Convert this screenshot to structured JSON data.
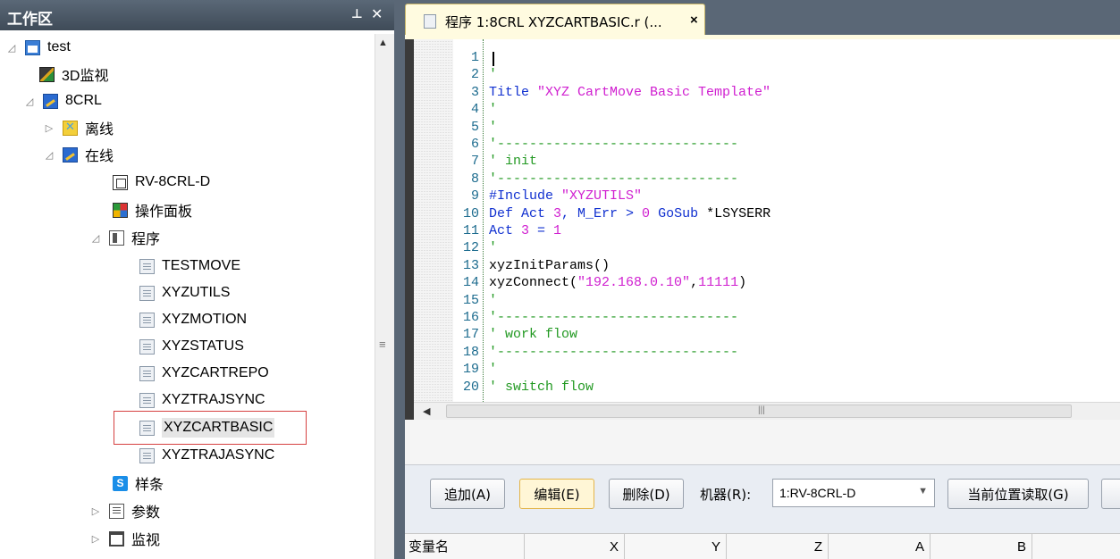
{
  "workspace": {
    "title": "工作区",
    "pin_glyph": "ᵖ",
    "close_glyph": "✕"
  },
  "tree": {
    "project": "test",
    "monitor3d": "3D监视",
    "robot": "8CRL",
    "offline": "离线",
    "online": "在线",
    "controller": "RV-8CRL-D",
    "op_panel": "操作面板",
    "programs": "程序",
    "program_files": [
      "TESTMOVE",
      "XYZUTILS",
      "XYZMOTION",
      "XYZSTATUS",
      "XYZCARTREPO",
      "XYZTRAJSYNC",
      "XYZCARTBASIC",
      "XYZTRAJASYNC"
    ],
    "selected": "XYZCARTBASIC",
    "spline": "样条",
    "params": "参数",
    "monitor": "监视"
  },
  "editor_tab": {
    "title": "程序 1:8CRL XYZCARTBASIC.r (...",
    "close_glyph": "×"
  },
  "code_lines": [
    {
      "n": "1",
      "parts": [
        {
          "t": "",
          "c": "tx"
        }
      ]
    },
    {
      "n": "2",
      "parts": [
        {
          "t": "'",
          "c": "cm"
        }
      ]
    },
    {
      "n": "3",
      "parts": [
        {
          "t": "Title ",
          "c": "kw"
        },
        {
          "t": "\"XYZ CartMove Basic Template\"",
          "c": "str"
        }
      ]
    },
    {
      "n": "4",
      "parts": [
        {
          "t": "'",
          "c": "cm"
        }
      ]
    },
    {
      "n": "5",
      "parts": [
        {
          "t": "'",
          "c": "cm"
        }
      ]
    },
    {
      "n": "6",
      "parts": [
        {
          "t": "'------------------------------",
          "c": "cm"
        }
      ]
    },
    {
      "n": "7",
      "parts": [
        {
          "t": "' init",
          "c": "cm"
        }
      ]
    },
    {
      "n": "8",
      "parts": [
        {
          "t": "'------------------------------",
          "c": "cm"
        }
      ]
    },
    {
      "n": "9",
      "parts": [
        {
          "t": "#Include ",
          "c": "kw"
        },
        {
          "t": "\"XYZUTILS\"",
          "c": "str"
        }
      ]
    },
    {
      "n": "10",
      "parts": [
        {
          "t": "Def Act ",
          "c": "kw"
        },
        {
          "t": "3",
          "c": "str"
        },
        {
          "t": ", M_Err > ",
          "c": "kw"
        },
        {
          "t": "0",
          "c": "str"
        },
        {
          "t": " GoSub ",
          "c": "kw"
        },
        {
          "t": "*LSYSERR",
          "c": "tx"
        }
      ]
    },
    {
      "n": "11",
      "parts": [
        {
          "t": "Act ",
          "c": "kw"
        },
        {
          "t": "3",
          "c": "str"
        },
        {
          "t": " = ",
          "c": "kw"
        },
        {
          "t": "1",
          "c": "str"
        }
      ]
    },
    {
      "n": "12",
      "parts": [
        {
          "t": "'",
          "c": "cm"
        }
      ]
    },
    {
      "n": "13",
      "parts": [
        {
          "t": "xyzInitParams()",
          "c": "tx"
        }
      ]
    },
    {
      "n": "14",
      "parts": [
        {
          "t": "xyzConnect(",
          "c": "tx"
        },
        {
          "t": "\"192.168.0.10\"",
          "c": "str"
        },
        {
          "t": ",",
          "c": "tx"
        },
        {
          "t": "11111",
          "c": "str"
        },
        {
          "t": ")",
          "c": "tx"
        }
      ]
    },
    {
      "n": "15",
      "parts": [
        {
          "t": "'",
          "c": "cm"
        }
      ]
    },
    {
      "n": "16",
      "parts": [
        {
          "t": "'------------------------------",
          "c": "cm"
        }
      ]
    },
    {
      "n": "17",
      "parts": [
        {
          "t": "' work flow",
          "c": "cm"
        }
      ]
    },
    {
      "n": "18",
      "parts": [
        {
          "t": "'------------------------------",
          "c": "cm"
        }
      ]
    },
    {
      "n": "19",
      "parts": [
        {
          "t": "'",
          "c": "cm"
        }
      ]
    },
    {
      "n": "20",
      "parts": [
        {
          "t": "' switch flow",
          "c": "cm"
        }
      ]
    }
  ],
  "position_panel": {
    "add_button": "追加(A)",
    "edit_button": "编辑(E)",
    "delete_button": "删除(D)",
    "robot_label": "机器(R):",
    "robot_value": "1:RV-8CRL-D",
    "read_pos_button": "当前位置读取(G)",
    "columns": [
      "变量名",
      "X",
      "Y",
      "Z",
      "A",
      "B"
    ]
  },
  "colors": {
    "header_bg": "#4b5866",
    "tab_bg": "#fffbe0",
    "comment": "#229922",
    "string": "#d020d0",
    "keyword": "#1030d0",
    "line_number": "#1c6b8e",
    "selection_outline": "#d64040"
  }
}
